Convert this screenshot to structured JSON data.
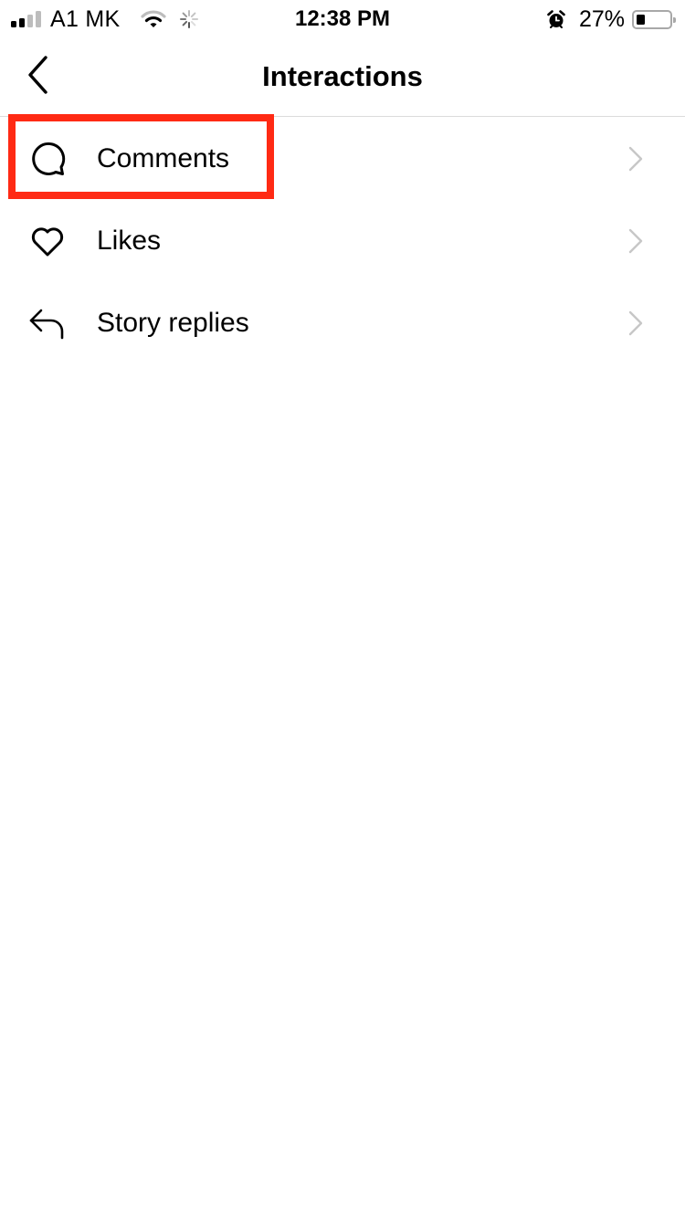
{
  "status_bar": {
    "carrier": "A1 MK",
    "signal_bars_filled": 2,
    "signal_bars_total": 4,
    "time": "12:38 PM",
    "battery_percent_label": "27%",
    "battery_level": 0.27,
    "icons": [
      "signal-icon",
      "wifi-icon",
      "activity-spinner-icon",
      "alarm-icon",
      "battery-icon"
    ]
  },
  "nav": {
    "title": "Interactions",
    "back_icon": "chevron-left-icon"
  },
  "list": {
    "items": [
      {
        "label": "Comments",
        "icon": "comment-bubble-icon",
        "highlighted": true
      },
      {
        "label": "Likes",
        "icon": "heart-icon",
        "highlighted": false
      },
      {
        "label": "Story replies",
        "icon": "reply-arrow-icon",
        "highlighted": false
      }
    ]
  },
  "colors": {
    "highlight": "#ff2a14",
    "divider": "#dbdbdb",
    "chevron": "#c7c7c7",
    "text": "#000000"
  }
}
